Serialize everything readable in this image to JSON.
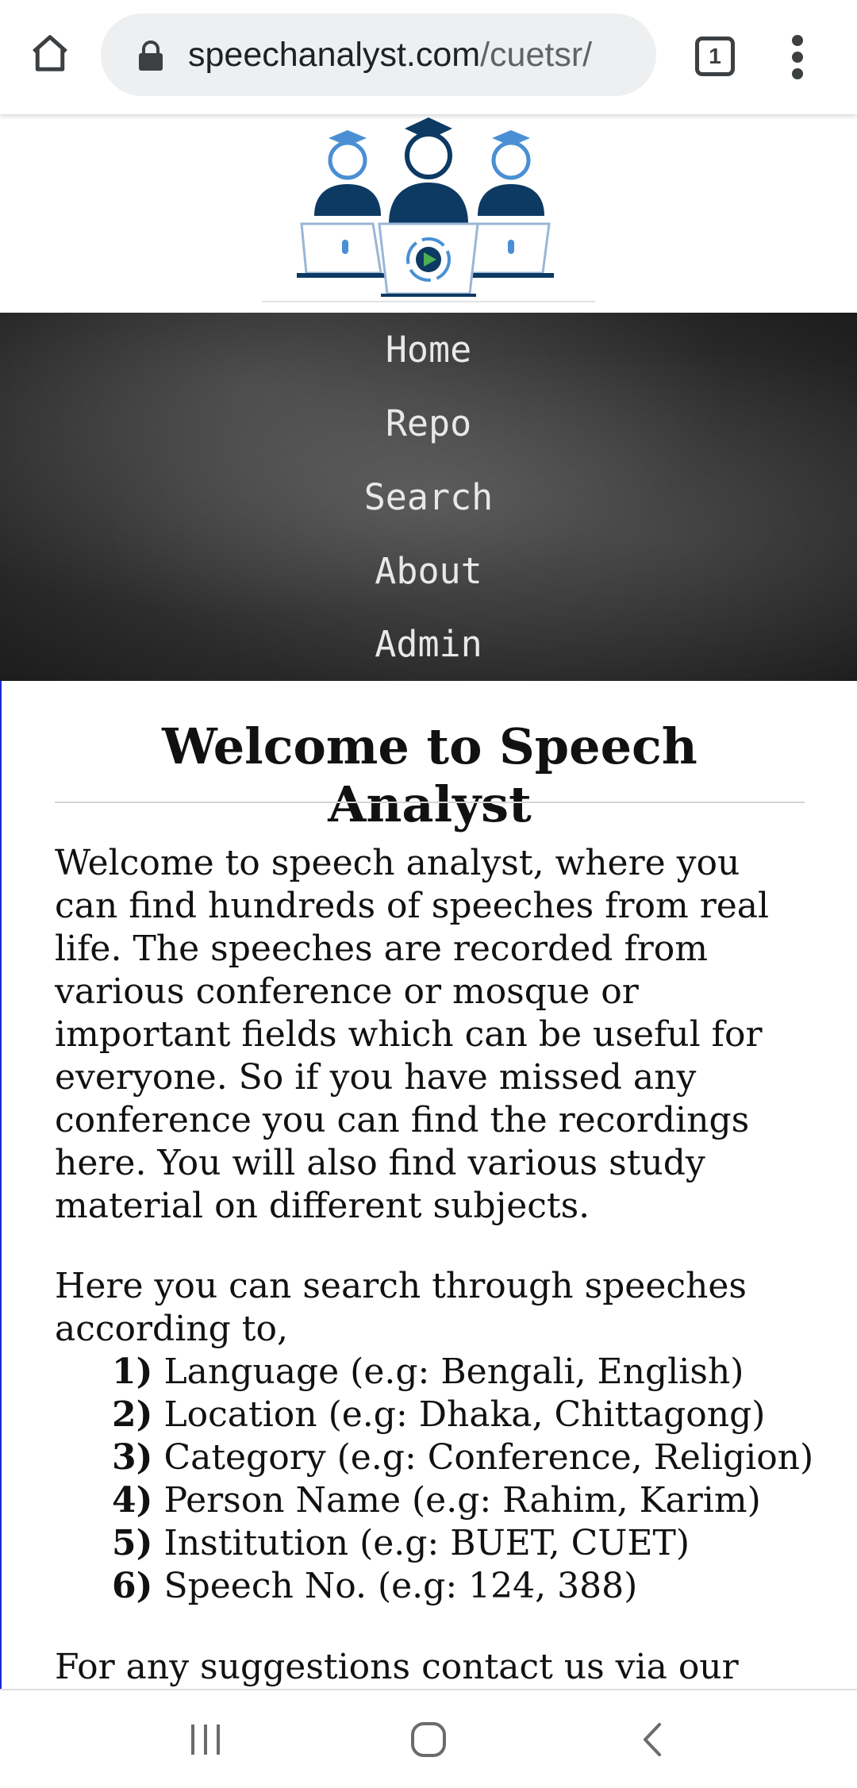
{
  "browser": {
    "url_host": "speechanalyst.com",
    "url_path": "/cuetsr/",
    "tab_count": "1",
    "icons": {
      "home": "home-icon",
      "lock": "lock-icon",
      "tabs": "tab-switcher-icon",
      "menu": "more-vert-icon"
    }
  },
  "nav": {
    "items": [
      {
        "label": "Home"
      },
      {
        "label": "Repo"
      },
      {
        "label": "Search"
      },
      {
        "label": "About"
      },
      {
        "label": "Admin"
      }
    ]
  },
  "main": {
    "title": "Welcome to Speech Analyst",
    "intro": "Welcome to speech analyst, where you can find hundreds of speeches from real life. The speeches are recorded from various conference or mosque or important fields which can be useful for everyone. So if you have missed any conference you can find the recordings here. You will also find various study material on different subjects.",
    "search_intro": "Here you can search through speeches according to,",
    "criteria": [
      {
        "num": "1)",
        "text": "Language (e.g: Bengali, English)"
      },
      {
        "num": "2)",
        "text": "Location (e.g: Dhaka, Chittagong)"
      },
      {
        "num": "3)",
        "text": "Category (e.g: Conference, Religion)"
      },
      {
        "num": "4)",
        "text": "Person Name (e.g: Rahim, Karim)"
      },
      {
        "num": "5)",
        "text": "Institution (e.g: BUET, CUET)"
      },
      {
        "num": "6)",
        "text": "Speech No. (e.g: 124, 388)"
      }
    ],
    "contact": "For any suggestions contact us via our"
  },
  "system_nav": {
    "icons": {
      "recents": "recents-icon",
      "home": "home-circle-icon",
      "back": "back-icon"
    }
  },
  "colors": {
    "accent_blue": "#4a8fd4",
    "logo_navy": "#0d3a63",
    "nav_text": "#e8e8e8",
    "left_rule": "#1a2bd4"
  }
}
